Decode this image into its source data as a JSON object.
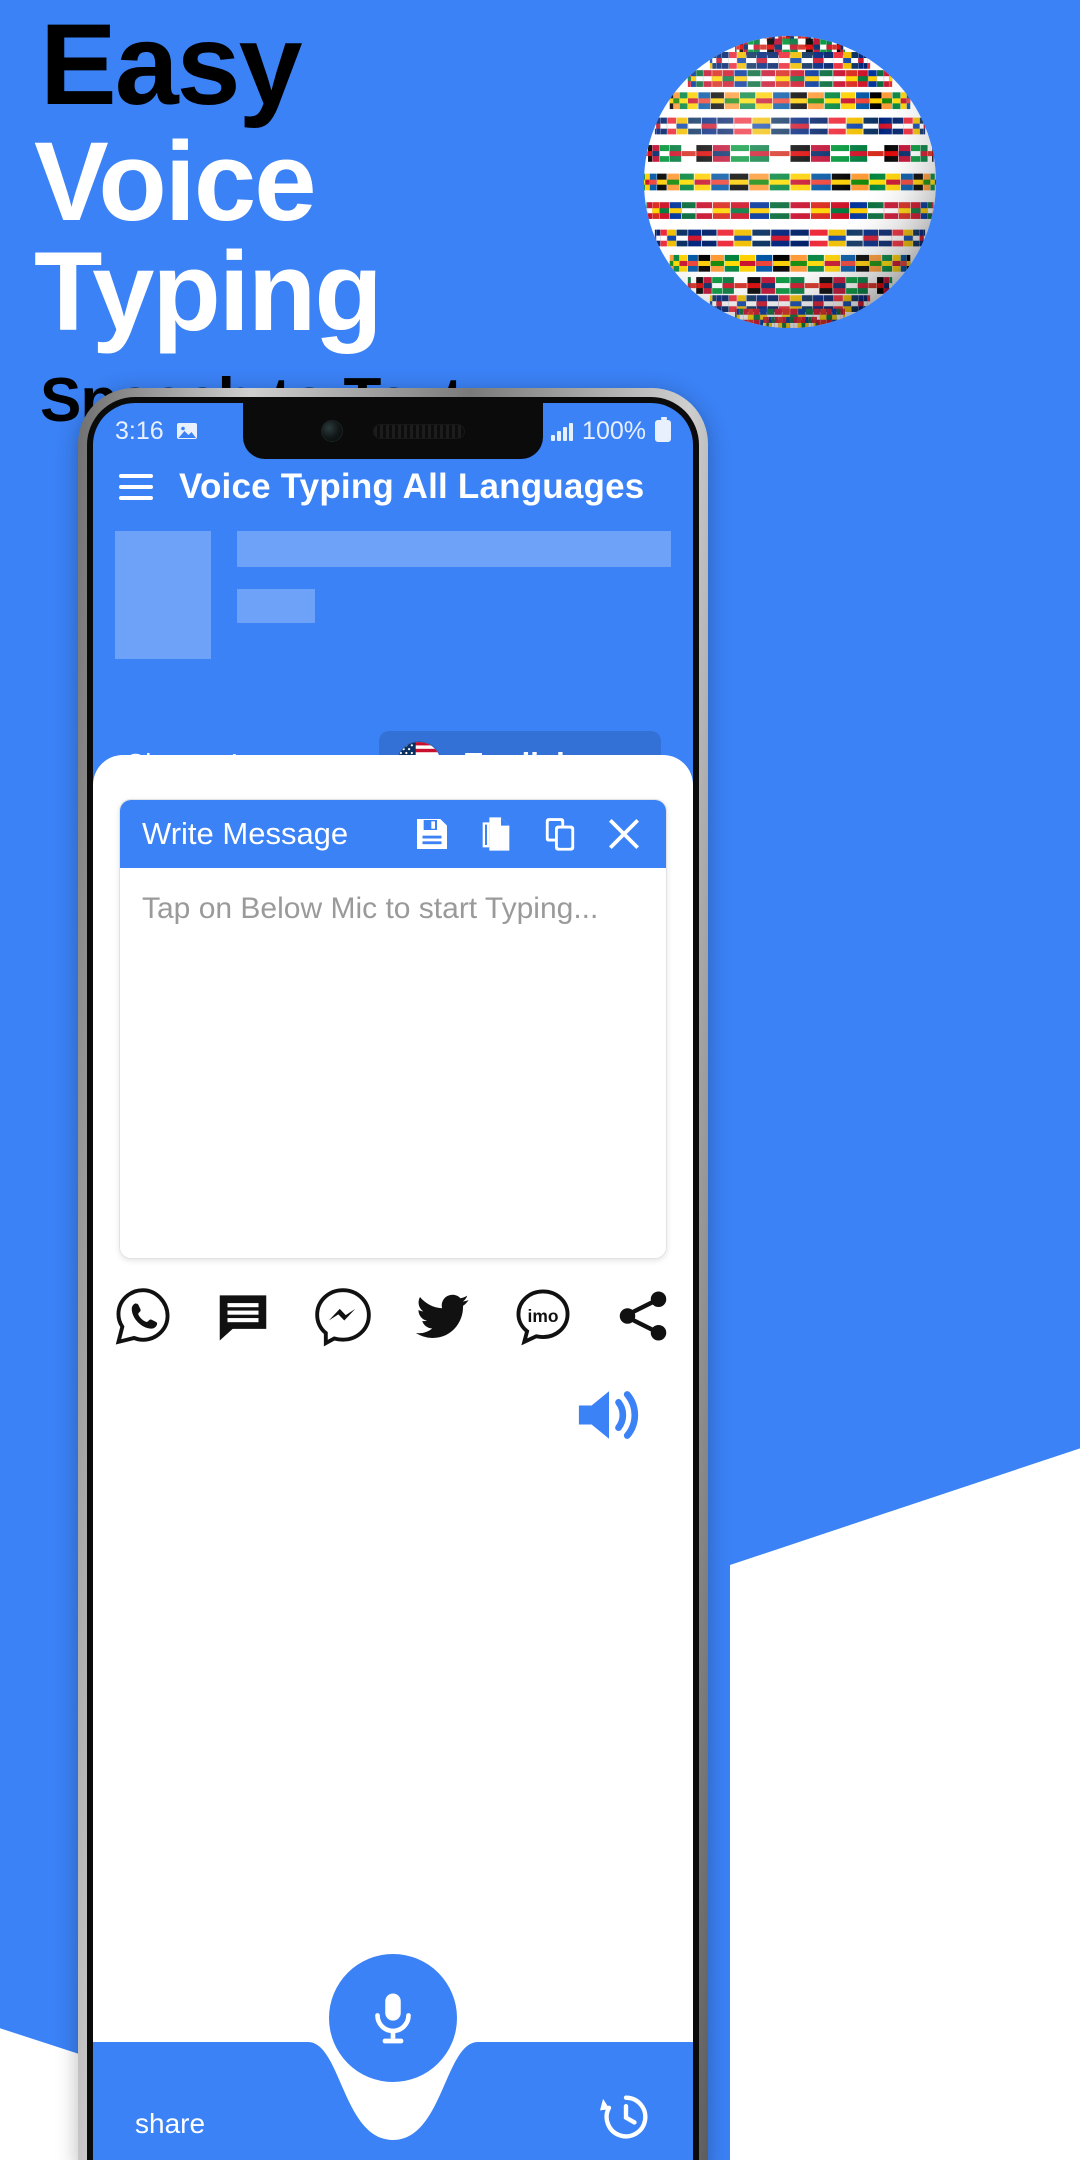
{
  "promo": {
    "line1": "Easy",
    "line2": "Voice",
    "line3": "Typing",
    "subtitle": "Speech to Text",
    "globe_icon": "world-flags-globe",
    "bg_color": "#3b82f6",
    "line1_color": "#000000",
    "line2_color": "#ffffff",
    "line3_color": "#ffffff",
    "subtitle_color": "#000000"
  },
  "phone": {
    "statusbar": {
      "time": "3:16",
      "image_icon": "image-icon",
      "signal_icon": "signal-bars-icon",
      "battery_percent": "100%",
      "battery_icon": "battery-full-icon"
    },
    "appbar": {
      "menu_icon": "hamburger-menu-icon",
      "title": "Voice Typing All Languages",
      "bg_color": "#3b82f6"
    },
    "language": {
      "label": "Change Language:",
      "flag_icon": "us-flag-icon",
      "selected": "English",
      "caret_icon": "chevron-down-icon"
    },
    "card": {
      "title": "Write Message",
      "actions": [
        {
          "name": "save-icon",
          "label": "Save"
        },
        {
          "name": "new-file-icon",
          "label": "New"
        },
        {
          "name": "copy-icon",
          "label": "Copy"
        },
        {
          "name": "close-icon",
          "label": "Close"
        }
      ],
      "placeholder": "Tap on Below Mic to start Typing...",
      "text_value": ""
    },
    "share_icons": [
      {
        "name": "whatsapp-icon",
        "label": "WhatsApp"
      },
      {
        "name": "sms-icon",
        "label": "SMS"
      },
      {
        "name": "messenger-icon",
        "label": "Messenger"
      },
      {
        "name": "twitter-icon",
        "label": "Twitter"
      },
      {
        "name": "imo-icon",
        "label": "imo"
      },
      {
        "name": "share-icon",
        "label": "Share"
      }
    ],
    "speaker_icon": "speaker-volume-icon",
    "footer": {
      "label": "share",
      "history_icon": "history-clock-icon",
      "mic_icon": "microphone-icon",
      "bg_color": "#3b82f6"
    }
  }
}
